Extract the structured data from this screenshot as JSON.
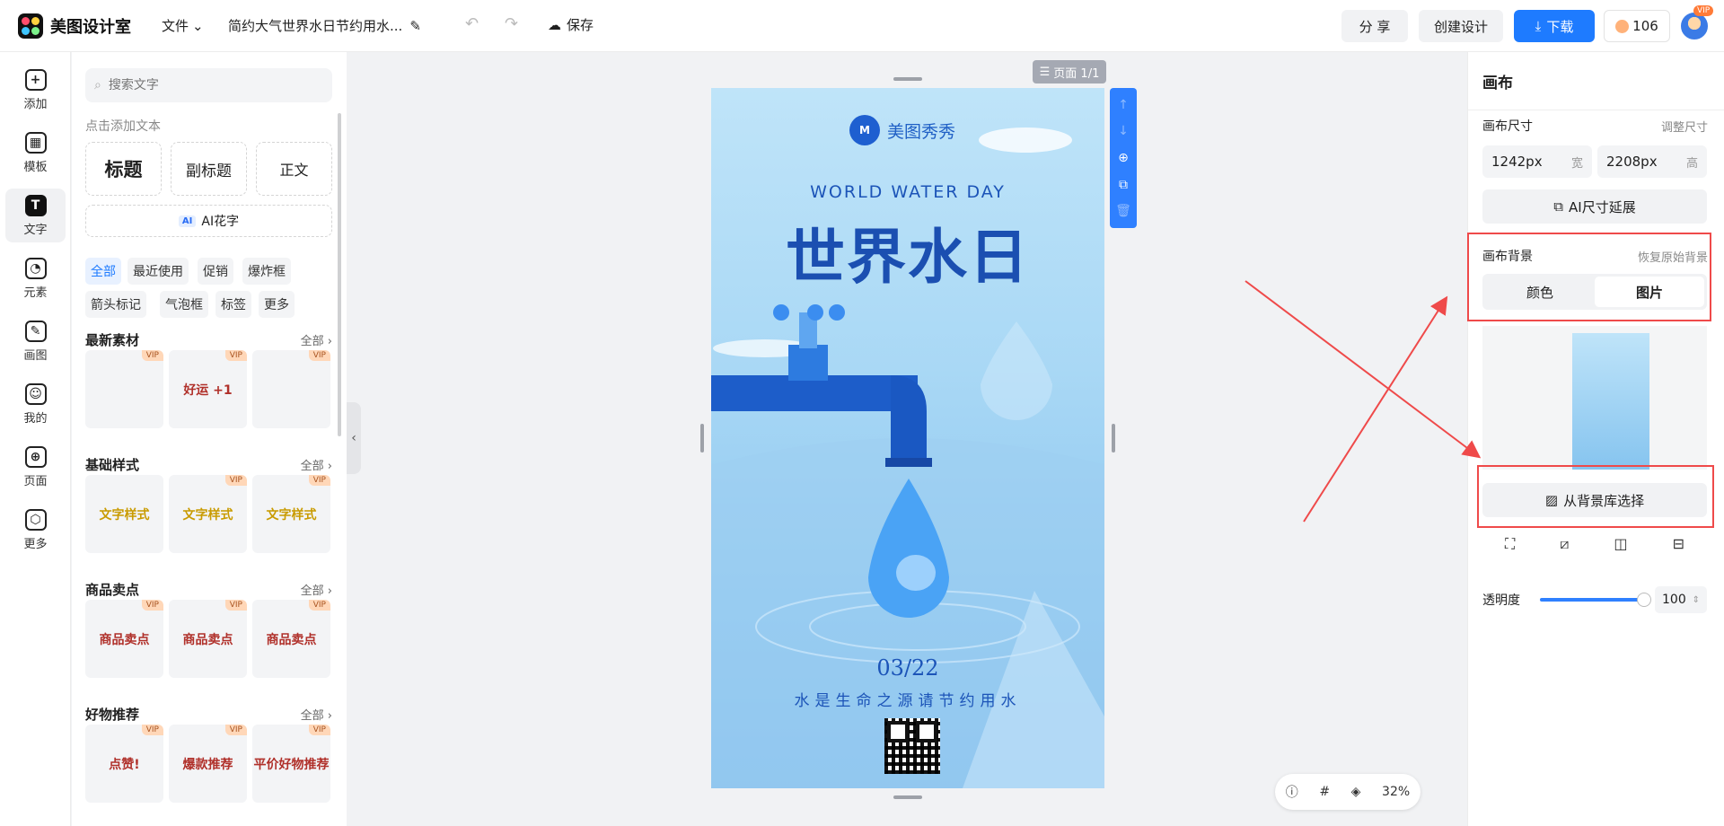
{
  "app": {
    "name": "美图设计室"
  },
  "topbar": {
    "file_menu": "文件",
    "doc_title": "简约大气世界水日节约用水...",
    "save_label": "保存",
    "share_label": "分 享",
    "create_label": "创建设计",
    "download_label": "下载",
    "coins": "106",
    "vip_badge": "VIP"
  },
  "leftnav": {
    "items": [
      {
        "label": "添加",
        "icon": "plus-icon",
        "glyph": "+"
      },
      {
        "label": "模板",
        "icon": "template-icon",
        "glyph": "▦"
      },
      {
        "label": "文字",
        "icon": "text-icon",
        "glyph": "T"
      },
      {
        "label": "元素",
        "icon": "element-icon",
        "glyph": "◔"
      },
      {
        "label": "画图",
        "icon": "draw-icon",
        "glyph": "✎"
      },
      {
        "label": "我的",
        "icon": "user-icon",
        "glyph": "☺"
      },
      {
        "label": "页面",
        "icon": "page-icon",
        "glyph": "⊕"
      },
      {
        "label": "更多",
        "icon": "cube-icon",
        "glyph": "⬡"
      }
    ],
    "active_index": 2
  },
  "text_panel": {
    "search_placeholder": "搜索文字",
    "click_add_label": "点击添加文本",
    "title_btn": "标题",
    "subtitle_btn": "副标题",
    "body_btn": "正文",
    "ai_tag": "AI",
    "ai_btn": "AI花字",
    "chips": [
      "全部",
      "最近使用",
      "促销",
      "爆炸框",
      "箭头标记",
      "气泡框",
      "标签",
      "更多"
    ],
    "active_chip": "全部",
    "all_label": "全部",
    "sections": [
      {
        "title": "最新素材",
        "tiles": [
          {
            "text": "",
            "vip": true
          },
          {
            "text": "好运 +1",
            "vip": true
          },
          {
            "text": "",
            "vip": true
          }
        ]
      },
      {
        "title": "基础样式",
        "tiles": [
          {
            "text": "文字样式",
            "vip": false
          },
          {
            "text": "文字样式",
            "vip": true
          },
          {
            "text": "文字样式",
            "vip": true
          }
        ]
      },
      {
        "title": "商品卖点",
        "tiles": [
          {
            "text": "商品卖点",
            "vip": true
          },
          {
            "text": "商品卖点",
            "vip": true
          },
          {
            "text": "商品卖点",
            "vip": true
          }
        ]
      },
      {
        "title": "好物推荐",
        "tiles": [
          {
            "text": "点赞!",
            "vip": true
          },
          {
            "text": "爆款推荐",
            "vip": true
          },
          {
            "text": "平价好物推荐",
            "vip": true
          }
        ]
      }
    ],
    "vip_label": "VIP"
  },
  "canvas": {
    "page_indicator": "页面 1/1",
    "zoom": "32%",
    "design": {
      "brand": "美图秀秀",
      "headline_en": "WORLD WATER DAY",
      "headline_cn": "世界水日",
      "date": "03/22",
      "slogan": "水是生命之源请节约用水"
    }
  },
  "right_panel": {
    "title": "画布",
    "canvas_size_label": "画布尺寸",
    "adjust_size_link": "调整尺寸",
    "width_value": "1242px",
    "width_unit": "宽",
    "height_value": "2208px",
    "height_unit": "高",
    "ai_expand_btn": "AI尺寸延展",
    "bg_label": "画布背景",
    "restore_bg_link": "恢复原始背景",
    "tab_color": "颜色",
    "tab_image": "图片",
    "active_tab": "图片",
    "bg_library_btn": "从背景库选择",
    "opacity_label": "透明度",
    "opacity_value": "100"
  },
  "colors": {
    "accent": "#1e7bff",
    "annotation_red": "#ef4a4a",
    "title_blue": "#1b4fb1"
  }
}
